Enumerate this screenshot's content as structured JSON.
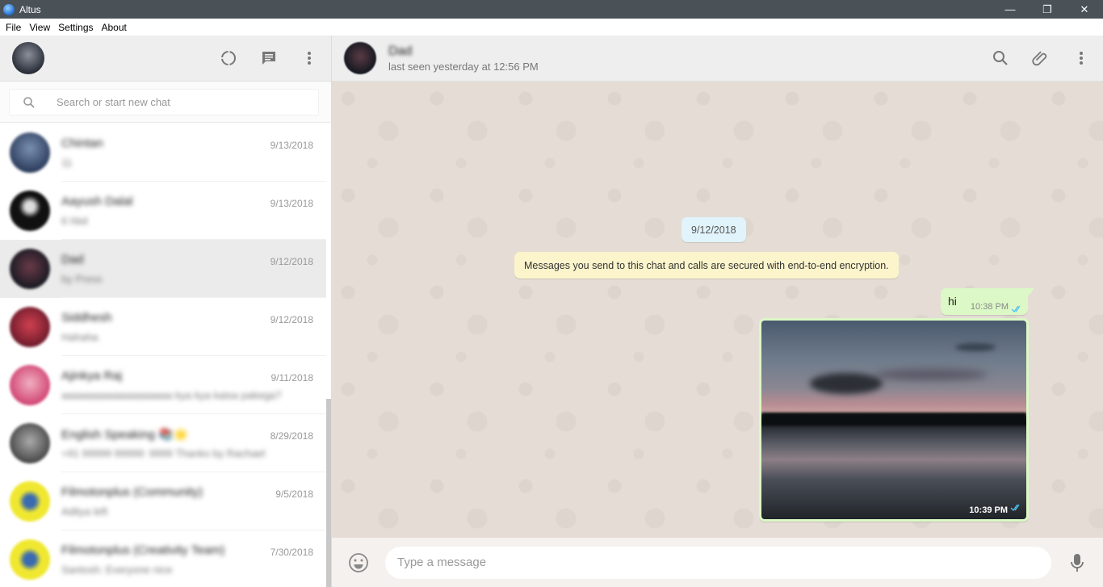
{
  "window": {
    "title": "Altus"
  },
  "menu": {
    "items": [
      "File",
      "View",
      "Settings",
      "About"
    ]
  },
  "search": {
    "placeholder": "Search or start new chat"
  },
  "chats": [
    {
      "name": "Chintan",
      "preview": "11",
      "date": "9/13/2018",
      "avatar_color": "#3b5a8a"
    },
    {
      "name": "Aayush Dalal",
      "preview": "6 hbd",
      "date": "9/13/2018",
      "avatar_color": "#111111"
    },
    {
      "name": "Dad",
      "preview": "by Press",
      "date": "9/12/2018",
      "avatar_color": "#3a2a34",
      "active": true
    },
    {
      "name": "Siddhesh",
      "preview": "Hahaha",
      "date": "9/12/2018",
      "avatar_color": "#b23a4a"
    },
    {
      "name": "Ajinkya Raj",
      "preview": "aaaaaaaaaaaaaaaaaaa kya kya kaisa pakega?",
      "date": "9/11/2018",
      "avatar_color": "#d98aa0"
    },
    {
      "name": "English Speaking 📚🌟",
      "preview": "+91 99999 99999: 9999 Thanks by Rachael",
      "date": "8/29/2018",
      "avatar_color": "#6a6a6a"
    },
    {
      "name": "Filmotonplus (Community)",
      "preview": "Aditya left",
      "date": "9/5/2018",
      "avatar_color": "#e8e030"
    },
    {
      "name": "Filmotonplus (Creativity Team)",
      "preview": "Santosh: Everyone nice",
      "date": "7/30/2018",
      "avatar_color": "#e8e030"
    }
  ],
  "conversation": {
    "contact_name": "Dad",
    "last_seen": "last seen yesterday at 12:56 PM",
    "date_pill": "9/12/2018",
    "system_message": "Messages you send to this chat and calls are secured with end-to-end encryption.",
    "messages": [
      {
        "text": "hi",
        "time": "10:38 PM"
      },
      {
        "type": "image",
        "time": "10:39 PM"
      }
    ]
  },
  "composer": {
    "placeholder": "Type a message"
  },
  "colors": {
    "accent_tick": "#4fc3f7",
    "outgoing_bubble": "#dcf8c6",
    "chat_bg": "#e5ddd5"
  }
}
